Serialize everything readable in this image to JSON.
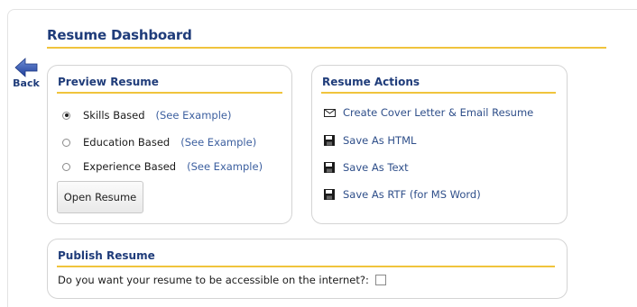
{
  "dashboard": {
    "title": "Resume Dashboard"
  },
  "nav": {
    "back_label": "Back"
  },
  "preview": {
    "title": "Preview Resume",
    "options": [
      {
        "label": "Skills Based",
        "link": "(See Example)",
        "checked": true
      },
      {
        "label": "Education Based",
        "link": "(See Example)",
        "checked": false
      },
      {
        "label": "Experience Based",
        "link": "(See Example)",
        "checked": false
      }
    ],
    "open_button": "Open Resume"
  },
  "actions": {
    "title": "Resume Actions",
    "items": [
      {
        "label": "Create Cover Letter & Email Resume",
        "icon": "envelope-icon"
      },
      {
        "label": "Save As HTML",
        "icon": "floppy-disk-icon"
      },
      {
        "label": "Save As Text",
        "icon": "floppy-disk-icon"
      },
      {
        "label": "Save As RTF (for MS Word)",
        "icon": "floppy-disk-icon"
      }
    ]
  },
  "publish": {
    "title": "Publish Resume",
    "question": "Do you want your resume to be accessible on the internet?:",
    "checked": false
  },
  "colors": {
    "heading": "#1f3c7a",
    "accent_rule": "#f0c43c",
    "link": "#3c5f9f",
    "back_arrow": "#2b4fa8"
  }
}
